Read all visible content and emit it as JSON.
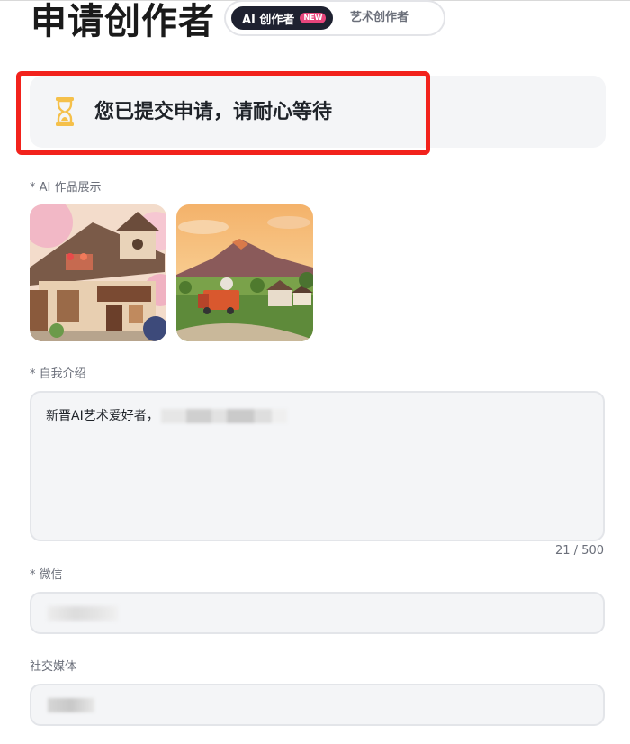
{
  "header": {
    "title": "申请创作者",
    "tabs": [
      {
        "label": "AI 创作者",
        "badge": "NEW",
        "active": true
      },
      {
        "label": "艺术创作者",
        "active": false
      }
    ]
  },
  "status": {
    "icon": "hourglass-icon",
    "message": "您已提交申请，请耐心等待"
  },
  "form": {
    "works": {
      "label": "* AI 作品展示",
      "images": [
        "cherry-blossom-house-artwork",
        "mountain-truck-village-artwork"
      ]
    },
    "intro": {
      "label": "* 自我介绍",
      "value": "新晋AI艺术爱好者，",
      "count": "21 / 500"
    },
    "wechat": {
      "label": "* 微信",
      "value": ""
    },
    "social": {
      "label": "社交媒体",
      "value": ""
    }
  },
  "colors": {
    "accent_dark": "#1e2130",
    "badge_pink": "#e8457c",
    "highlight_red": "#f2221c",
    "hourglass_gold": "#f5c04a",
    "field_bg": "#f4f5f7"
  }
}
